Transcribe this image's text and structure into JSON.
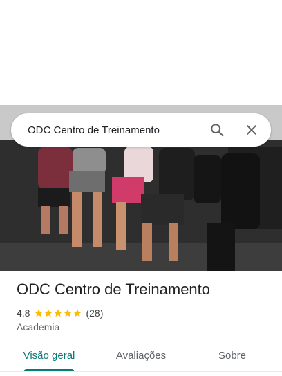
{
  "search": {
    "query": "ODC Centro de Treinamento"
  },
  "icons": {
    "search": "search-icon",
    "close": "close-icon",
    "star": "star-icon"
  },
  "place": {
    "name": "ODC Centro de Treinamento",
    "rating": "4,8",
    "stars": 5,
    "reviews": "(28)",
    "category": "Academia"
  },
  "tabs": [
    {
      "label": "Visão geral",
      "active": true
    },
    {
      "label": "Avaliações",
      "active": false
    },
    {
      "label": "Sobre",
      "active": false
    }
  ],
  "colors": {
    "accent": "#0b7a75",
    "star": "#fbbc04",
    "text": "#202124",
    "muted": "#5f6368"
  }
}
